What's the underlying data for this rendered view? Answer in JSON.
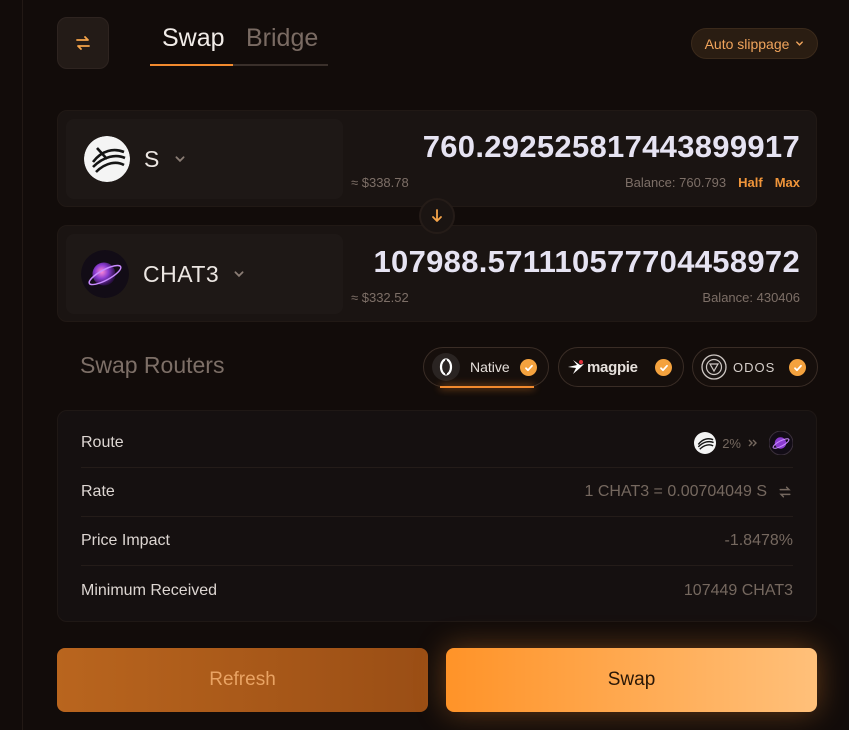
{
  "header": {
    "toggle_icon": "swap-arrows-icon",
    "tabs": [
      {
        "label": "Swap",
        "active": true
      },
      {
        "label": "Bridge",
        "active": false
      }
    ],
    "slippage_label": "Auto slippage"
  },
  "from_token": {
    "symbol": "S",
    "icon": "sonic-token-icon",
    "amount": "760.292525817443899917",
    "usd_value": "≈ $338.78",
    "balance": "Balance: 760.793",
    "half_label": "Half",
    "max_label": "Max"
  },
  "to_token": {
    "symbol": "CHAT3",
    "icon": "chat3-token-icon",
    "amount": "107988.571110577704458972",
    "usd_value": "≈ $332.52",
    "balance": "Balance: 430406"
  },
  "routers": {
    "title": "Swap Routers",
    "items": [
      {
        "label": "Native",
        "icon": "native-router-icon",
        "selected": true
      },
      {
        "label": "magpie",
        "icon": "magpie-logo-icon",
        "selected": true
      },
      {
        "label": "ODOS",
        "icon": "odos-logo-icon",
        "selected": true
      }
    ]
  },
  "details": {
    "route_label": "Route",
    "route_pct": "2%",
    "rate_label": "Rate",
    "rate_value": "1 CHAT3 = 0.00704049 S",
    "impact_label": "Price Impact",
    "impact_value": "-1.8478%",
    "min_label": "Minimum Received",
    "min_value": "107449 CHAT3"
  },
  "actions": {
    "refresh_label": "Refresh",
    "swap_label": "Swap"
  },
  "colors": {
    "accent": "#f28a2e",
    "background": "#120c0a",
    "panel": "#1a1412"
  }
}
